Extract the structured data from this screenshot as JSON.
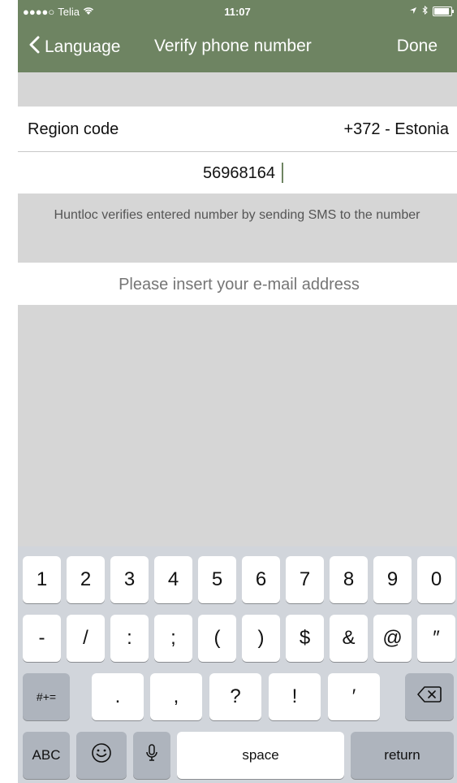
{
  "status_bar": {
    "carrier": "Telia",
    "signal": "●●●●○",
    "time": "11:07"
  },
  "nav": {
    "back_label": "Language",
    "title": "Verify phone number",
    "done_label": "Done"
  },
  "form": {
    "region_label": "Region code",
    "region_value": "+372 - Estonia",
    "phone_value": "56968164",
    "info_text": "Huntloc verifies entered number by sending SMS to the number",
    "email_placeholder": "Please insert your e-mail address"
  },
  "keyboard": {
    "row1": [
      "1",
      "2",
      "3",
      "4",
      "5",
      "6",
      "7",
      "8",
      "9",
      "0"
    ],
    "row2": [
      "-",
      "/",
      ":",
      ";",
      "(",
      ")",
      "$",
      "&",
      "@",
      "″"
    ],
    "row3_left": "#+=",
    "row3_keys": [
      ".",
      ",",
      "?",
      "!",
      "′"
    ],
    "row4_abc": "ABC",
    "space_label": "space",
    "return_label": "return"
  },
  "colors": {
    "nav_bg": "#6e8462",
    "screen_bg": "#d6d6d6",
    "keyboard_bg": "#d1d5db"
  }
}
